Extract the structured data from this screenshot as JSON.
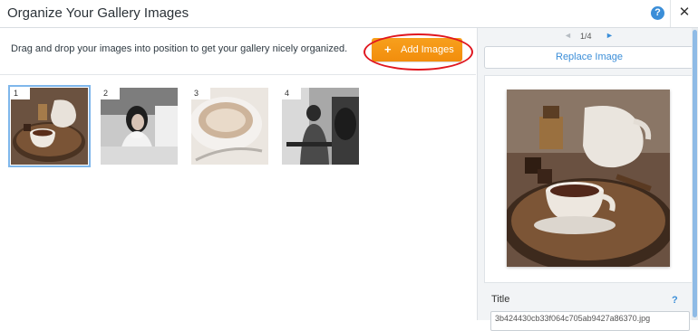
{
  "dialog": {
    "title": "Organize Your Gallery Images",
    "help_glyph": "?",
    "close_glyph": "✕"
  },
  "toolbar": {
    "instructions": "Drag and drop your images into position to get your gallery nicely organized.",
    "add_button_icon": "+",
    "add_button_label": "Add Images"
  },
  "thumbnails": [
    {
      "number": "1",
      "subject": "cocoa-cup-on-board",
      "selected": true
    },
    {
      "number": "2",
      "subject": "woman-drinking-coffee",
      "selected": false
    },
    {
      "number": "3",
      "subject": "latte-cup-closeup",
      "selected": false
    },
    {
      "number": "4",
      "subject": "man-in-cafe",
      "selected": false
    }
  ],
  "side_panel": {
    "pager": {
      "prev": "◄",
      "label": "1/4",
      "next": "►"
    },
    "replace_label": "Replace Image",
    "title_label": "Title",
    "title_help": "?",
    "title_value": "3b424430cb33f064c705ab9427a86370.jpg"
  },
  "colors": {
    "accent": "#3b8ed8",
    "add_button": "#f39210",
    "highlight_ring": "#e0161f"
  }
}
